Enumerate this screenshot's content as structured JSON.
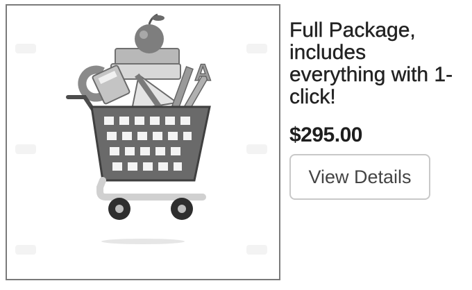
{
  "product": {
    "image_icon": "shopping-cart-with-school-supplies",
    "title": "Full Package, includes everything with 1-click!",
    "price": "$295.00",
    "details_label": "View Details"
  }
}
